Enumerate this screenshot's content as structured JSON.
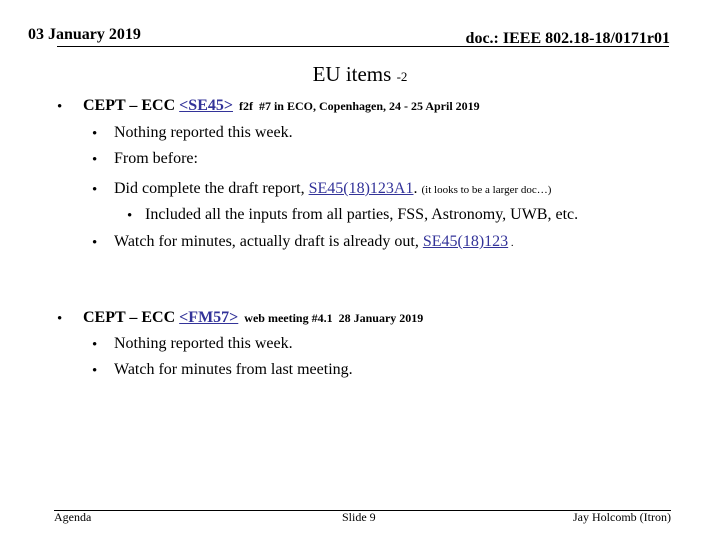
{
  "header": {
    "date": "03 January 2019",
    "doc_id": "doc.: IEEE 802.18-18/0171r01"
  },
  "title": {
    "main": "EU items",
    "suffix": "-2"
  },
  "sections": [
    {
      "bullet": "•",
      "prefix": "CEPT – ECC ",
      "link": "<SE45>",
      "detail": "  f2f  #7 in ECO, Copenhagen, 24 - 25 April 2019",
      "items": [
        {
          "bullet": "•",
          "text": "Nothing reported this week."
        },
        {
          "bullet": "•",
          "text": "From before:"
        },
        {
          "bullet": "•",
          "text": "Did complete the draft report, ",
          "link": "SE45(18)123A1",
          "after": ". ",
          "note": "(it looks to be a larger doc…)"
        },
        {
          "bullet": "•",
          "text": "Included all the inputs from all parties, FSS, Astronomy, UWB, etc."
        },
        {
          "bullet": "•",
          "text": "Watch for minutes, actually draft is already out, ",
          "link": "SE45(18)123",
          "after": " ."
        }
      ]
    },
    {
      "bullet": "•",
      "prefix": "CEPT – ECC ",
      "link": "<FM57>",
      "detail": "  web meeting #4.1  28 January 2019",
      "items": [
        {
          "bullet": "•",
          "text": "Nothing reported this week."
        },
        {
          "bullet": "•",
          "text": "Watch for minutes from last meeting."
        }
      ]
    }
  ],
  "footer": {
    "left": "Agenda",
    "center": "Slide 9",
    "right": "Jay Holcomb (Itron)"
  },
  "colors": {
    "link": "#333399",
    "text": "#000000",
    "background": "#ffffff"
  }
}
